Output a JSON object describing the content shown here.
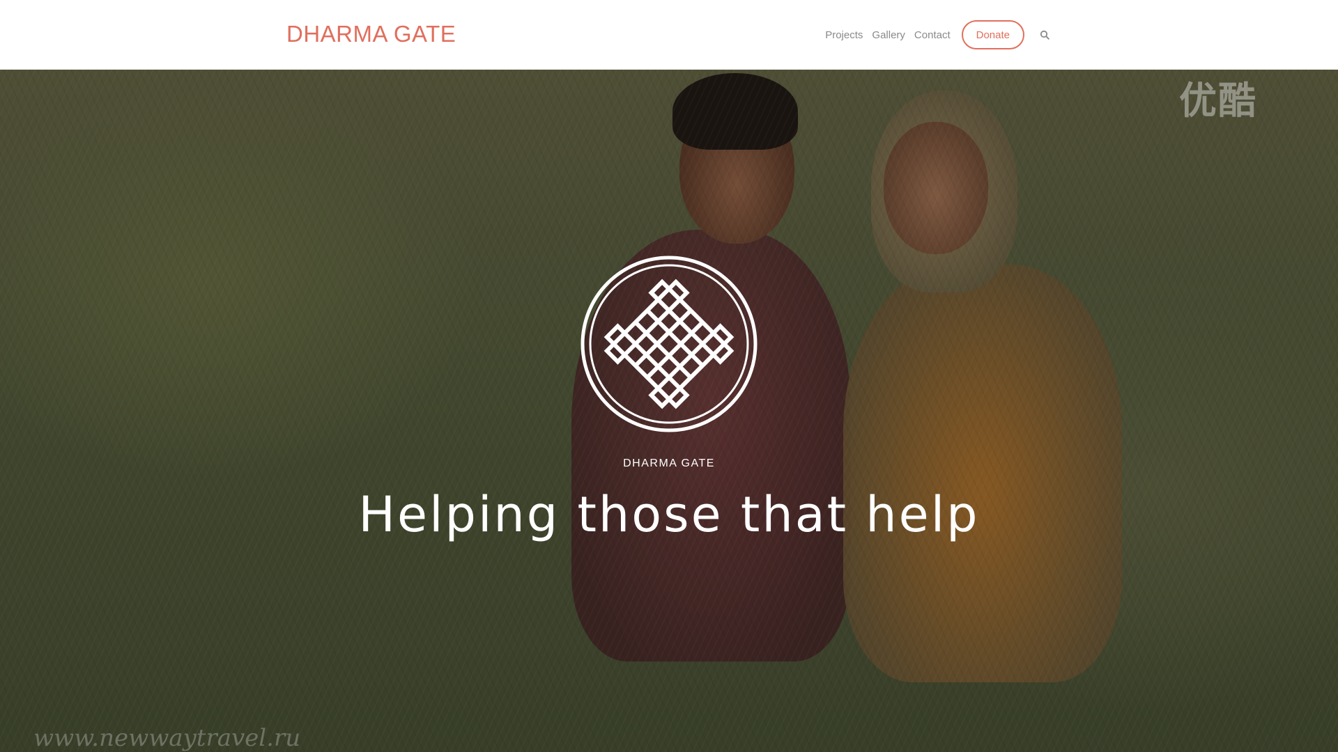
{
  "header": {
    "brand": "DHARMA GATE",
    "nav": [
      "Projects",
      "Gallery",
      "Contact"
    ],
    "donate_label": "Donate",
    "search_icon": "search-icon"
  },
  "hero": {
    "logo_icon": "endless-knot-icon",
    "kicker": "DHARMA GATE",
    "title": "Helping those that help",
    "watermark_top": "优酷",
    "watermark_bottom": "www.newwaytravel.ru"
  },
  "colors": {
    "brand": "#e06f5d",
    "nav_text": "#8a8a8a",
    "header_bg": "#ffffff",
    "hero_text": "#ffffff"
  }
}
